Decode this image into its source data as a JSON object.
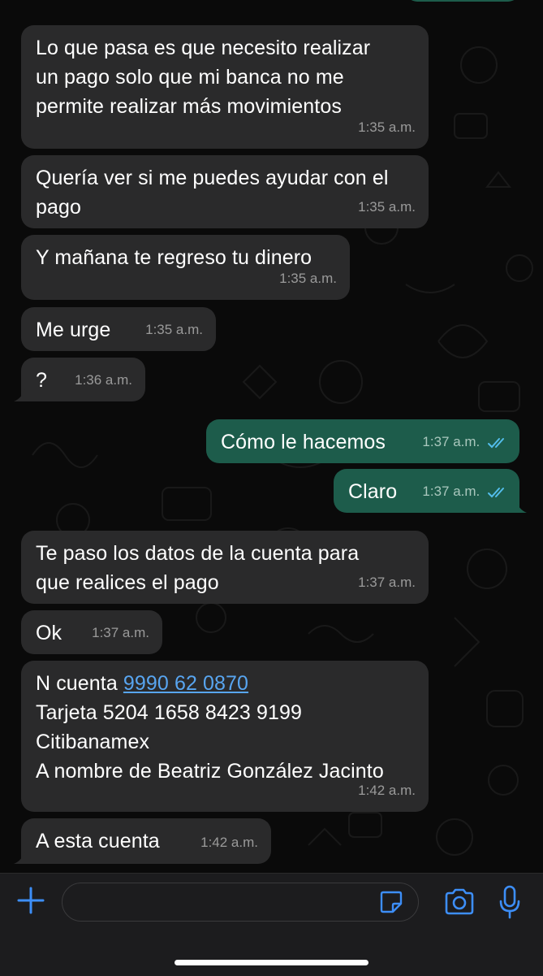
{
  "colors": {
    "incoming_bubble": "#2a2a2b",
    "outgoing_bubble": "#1d5c4b",
    "timestamp": "#9a9a9a",
    "link": "#58a5f0",
    "read_ticks": "#53bdeb",
    "accent_icons": "#3d8ef7"
  },
  "messages": [
    {
      "direction": "in",
      "text": "Lo que pasa es que necesito realizar\nun pago solo que mi banca no me\npermite realizar más movimientos",
      "time": "1:35 a.m."
    },
    {
      "direction": "in",
      "text": "Quería ver si me puedes ayudar con el\npago",
      "time": "1:35 a.m."
    },
    {
      "direction": "in",
      "text": "Y mañana te regreso tu dinero",
      "time": "1:35 a.m."
    },
    {
      "direction": "in",
      "text": "Me urge",
      "time": "1:35 a.m."
    },
    {
      "direction": "in",
      "text": "?",
      "time": "1:36 a.m."
    },
    {
      "direction": "out",
      "text": "Cómo le hacemos",
      "time": "1:37 a.m.",
      "status": "read"
    },
    {
      "direction": "out",
      "text": "Claro",
      "time": "1:37 a.m.",
      "status": "read"
    },
    {
      "direction": "in",
      "text": "Te paso los datos de la cuenta para\nque realices el pago",
      "time": "1:37 a.m."
    },
    {
      "direction": "in",
      "text": "Ok",
      "time": "1:37 a.m."
    },
    {
      "direction": "in",
      "account_label": "N cuenta ",
      "account_number": "9990 62 0870",
      "text": "Tarjeta 5204 1658 8423 9199\nCitibanamex\nA nombre de Beatriz González Jacinto",
      "time": "1:42 a.m."
    },
    {
      "direction": "in",
      "text": "A esta cuenta",
      "time": "1:42 a.m."
    }
  ],
  "input_bar": {
    "icons": [
      "plus-icon",
      "sticker-icon",
      "camera-icon",
      "microphone-icon"
    ]
  }
}
